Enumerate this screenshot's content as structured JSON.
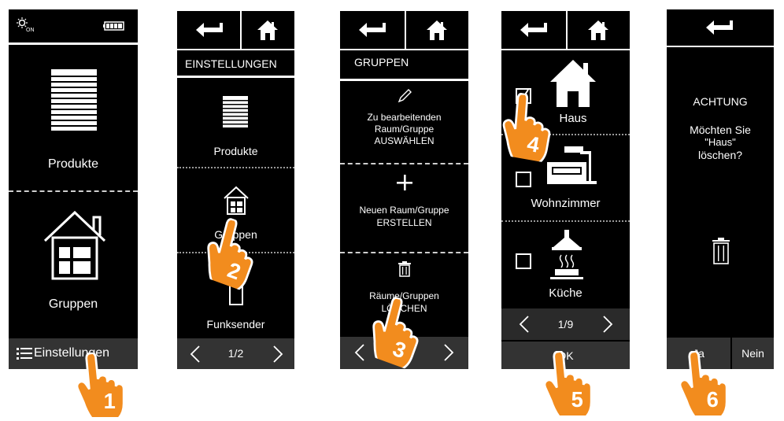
{
  "screen1": {
    "products_label": "Produkte",
    "groups_label": "Gruppen",
    "settings_label": "Einstellungen"
  },
  "screen2": {
    "title": "EINSTELLUNGEN",
    "items": [
      "Produkte",
      "Gruppen",
      "Funksender"
    ],
    "page": "1/2"
  },
  "screen3": {
    "title": "GRUPPEN",
    "edit_line1": "Zu bearbeitenden",
    "edit_line2": "Raum/Gruppe",
    "edit_line3": "AUSWÄHLEN",
    "create_line1": "Neuen Raum/Gruppe",
    "create_line2": "ERSTELLEN",
    "delete_line1": "Räume/Gruppen",
    "delete_line2": "LÖSCHEN"
  },
  "screen4": {
    "items": [
      {
        "label": "Haus",
        "checked": true
      },
      {
        "label": "Wohnzimmer",
        "checked": false
      },
      {
        "label": "Küche",
        "checked": false
      }
    ],
    "page": "1/9",
    "ok_label": "OK"
  },
  "screen5": {
    "heading": "ACHTUNG",
    "msg_line1": "Möchten Sie",
    "msg_line2": "\"Haus\"",
    "msg_line3": "löschen?",
    "yes_label": "Ja",
    "no_label": "Nein"
  },
  "steps": [
    "1",
    "2",
    "3",
    "4",
    "5",
    "6"
  ],
  "colors": {
    "accent": "#f28c1e",
    "screen": "#000000",
    "navbar": "#333333"
  }
}
